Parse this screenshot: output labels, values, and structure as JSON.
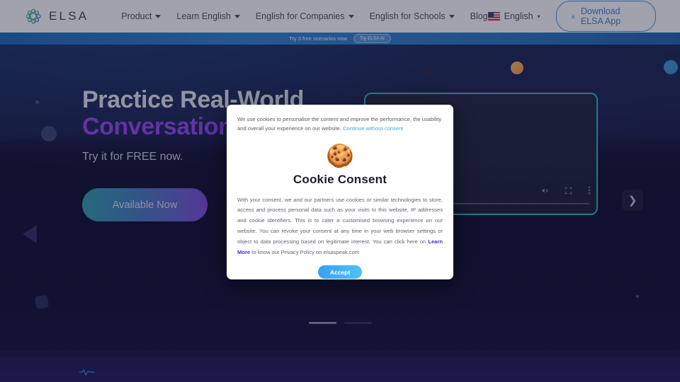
{
  "navbar": {
    "brand": "ELSA",
    "links": [
      {
        "label": "Product",
        "has_caret": true
      },
      {
        "label": "Learn English",
        "has_caret": true
      },
      {
        "label": "English for Companies",
        "has_caret": true
      },
      {
        "label": "English for Schools",
        "has_caret": true
      },
      {
        "label": "Blog",
        "has_caret": false
      }
    ],
    "language": "English",
    "language_caret": "▾",
    "download_label": "Download ELSA App"
  },
  "promo": {
    "text": "Try 3 free scenarios now",
    "pill_label": "Try ELSA AI"
  },
  "hero": {
    "title_line1": "Practice Real-World",
    "title_line2": "Conversations",
    "subtitle": "Try it for FREE now.",
    "cta_label": "Available Now",
    "accent_purple": "#8640d9",
    "accent_teal": "#2aa8b0"
  },
  "modal": {
    "notice_text_before": "We use cookies to personalise the content and improve the performance, the usability and overall your experience on our website. ",
    "notice_link": "Continue without consent",
    "icon": "cookie-icon",
    "icon_glyph": "🍪",
    "title": "Cookie Consent",
    "body_before": "With your consent, we and our partners use cookies or similar technologies to store, access and process personal data such as your visits to this website, IP addresses and cookie identifiers. This is to cater a customised browsing experience on our website. You can revoke your consent at any time in your web browser settings or object to data processing based on legitimate interest. You can click here on ",
    "body_link": "Learn More",
    "body_after": " to know our Privacy Policy on elsaspeak.com",
    "accept_label": "Accept"
  },
  "player": {
    "mute_icon": "mute-icon",
    "fullscreen_icon": "fullscreen-icon",
    "more_icon": "kebab-menu-icon",
    "next_icon": "chevron-right-icon",
    "next_glyph": "❯"
  },
  "carousel": {
    "slides": 2,
    "active_index": 0
  }
}
